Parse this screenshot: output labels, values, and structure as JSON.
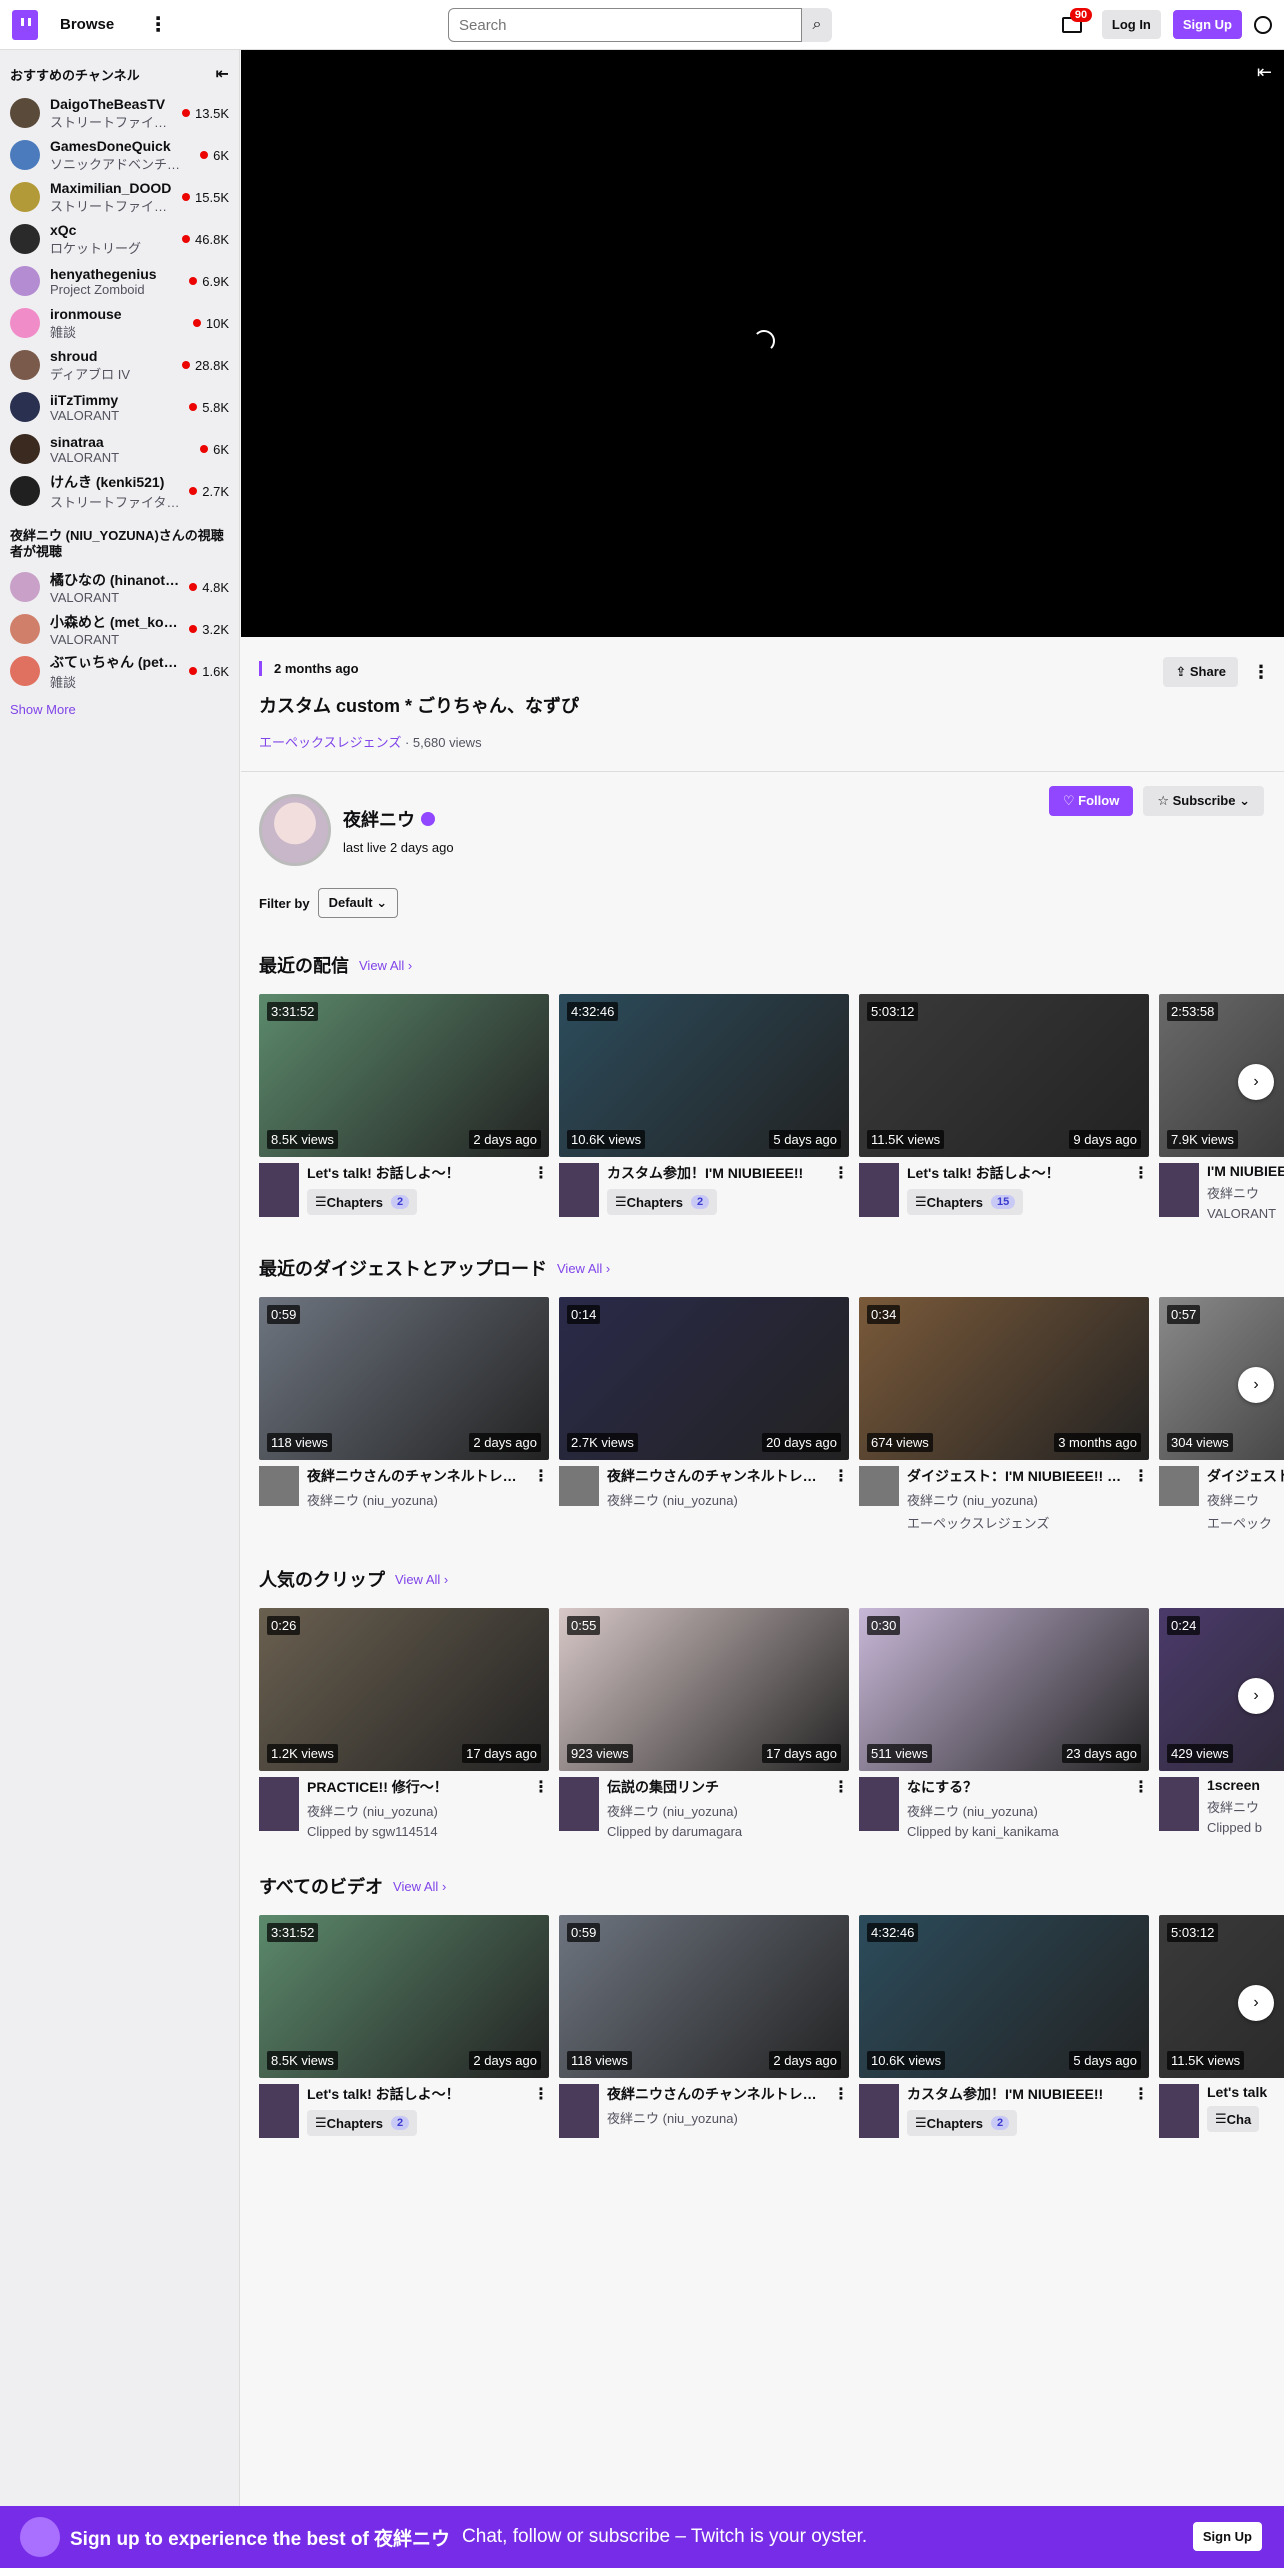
{
  "nav": {
    "browse": "Browse",
    "search_placeholder": "Search",
    "inbox_count": "90",
    "login": "Log In",
    "signup": "Sign Up"
  },
  "sidebar": {
    "title": "おすすめのチャンネル",
    "channels": [
      {
        "name": "DaigoTheBeasTV",
        "game": "ストリートファイ…",
        "viewers": "13.5K",
        "color": "#5a4a3a"
      },
      {
        "name": "GamesDoneQuick",
        "game": "ソニックアドベンチ…",
        "viewers": "6K",
        "color": "#4c7bbd"
      },
      {
        "name": "Maximilian_DOOD",
        "game": "ストリートファイ…",
        "viewers": "15.5K",
        "color": "#b39a39"
      },
      {
        "name": "xQc",
        "game": "ロケットリーグ",
        "viewers": "46.8K",
        "color": "#2a2a2a"
      },
      {
        "name": "henyathegenius",
        "game": "Project Zomboid",
        "viewers": "6.9K",
        "color": "#b48cd2"
      },
      {
        "name": "ironmouse",
        "game": "雑談",
        "viewers": "10K",
        "color": "#f08cc8"
      },
      {
        "name": "shroud",
        "game": "ディアブロ IV",
        "viewers": "28.8K",
        "color": "#7a5a4a"
      },
      {
        "name": "iiTzTimmy",
        "game": "VALORANT",
        "viewers": "5.8K",
        "color": "#2a3050"
      },
      {
        "name": "sinatraa",
        "game": "VALORANT",
        "viewers": "6K",
        "color": "#3a2a20"
      },
      {
        "name": "けんき (kenki521)",
        "game": "ストリートファイタ…",
        "viewers": "2.7K",
        "color": "#202020"
      }
    ],
    "viewers_also": "夜絆ニウ (NIU_YOZUNA)さんの視聴者が視聴",
    "also_channels": [
      {
        "name": "橘ひなの (hinanot…",
        "game": "VALORANT",
        "viewers": "4.8K",
        "color": "#c8a0c8"
      },
      {
        "name": "小森めと (met_ko…",
        "game": "VALORANT",
        "viewers": "3.2K",
        "color": "#d0806a"
      },
      {
        "name": "ぶてぃちゃん (petit…",
        "game": "雑談",
        "viewers": "1.6K",
        "color": "#e07060"
      }
    ],
    "show_more": "Show More"
  },
  "video": {
    "date": "2 months ago",
    "title": "カスタム custom * ごりちゃん、なずぴ",
    "game": "エーペックスレジェンズ",
    "views": "· 5,680 views",
    "share": "Share"
  },
  "creator": {
    "name": "夜絆ニウ",
    "last_live": "last live 2 days ago",
    "follow": "Follow",
    "subscribe": "Subscribe"
  },
  "filter": {
    "label": "Filter by",
    "value": "Default"
  },
  "sections": [
    {
      "title": "最近の配信",
      "view_all": "View All",
      "cards": [
        {
          "duration": "3:31:52",
          "views": "8.5K views",
          "age": "2 days ago",
          "title": "Let's talk! お話しよ～！",
          "chapters": "Chapters",
          "chapter_count": "2",
          "color": "#5c8a6c"
        },
        {
          "duration": "4:32:46",
          "views": "10.6K views",
          "age": "5 days ago",
          "title": "カスタム参加！I'M NIUBIEEE!!",
          "chapters": "Chapters",
          "chapter_count": "2",
          "color": "#2c4c5c"
        },
        {
          "duration": "5:03:12",
          "views": "11.5K views",
          "age": "9 days ago",
          "title": "Let's talk! お話しよ～！",
          "chapters": "Chapters",
          "chapter_count": "15",
          "color": "#3a3a3a"
        },
        {
          "duration": "2:53:58",
          "views": "7.9K views",
          "age": "",
          "title": "I'M NIUBIEEE",
          "sub1": "夜絆ニウ",
          "sub2": "VALORANT",
          "color": "#6a6a6a"
        }
      ]
    },
    {
      "title": "最近のダイジェストとアップロード",
      "view_all": "View All",
      "cards": [
        {
          "duration": "0:59",
          "views": "118 views",
          "age": "2 days ago",
          "title": "夜絆ニウさんのチャンネルトレ…",
          "sub1": "夜絆ニウ (niu_yozuna)",
          "color": "#6e7580"
        },
        {
          "duration": "0:14",
          "views": "2.7K views",
          "age": "20 days ago",
          "title": "夜絆ニウさんのチャンネルトレ…",
          "sub1": "夜絆ニウ (niu_yozuna)",
          "color": "#2a2a4a"
        },
        {
          "duration": "0:34",
          "views": "674 views",
          "age": "3 months ago",
          "title": "ダイジェスト：I'M NIUBIEEE!! p…",
          "sub1": "夜絆ニウ (niu_yozuna)",
          "sub2": "エーペックスレジェンズ",
          "color": "#7a5a3a"
        },
        {
          "duration": "0:57",
          "views": "304 views",
          "age": "",
          "title": "ダイジェスト",
          "sub1": "夜絆ニウ",
          "sub2": "エーペック",
          "color": "#8a8a8a"
        }
      ]
    },
    {
      "title": "人気のクリップ",
      "view_all": "View All",
      "cards": [
        {
          "duration": "0:26",
          "views": "1.2K views",
          "age": "17 days ago",
          "title": "PRACTICE!! 修行～！",
          "sub1": "夜絆ニウ (niu_yozuna)",
          "sub2": "Clipped by sgw114514",
          "color": "#6a6050"
        },
        {
          "duration": "0:55",
          "views": "923 views",
          "age": "17 days ago",
          "title": "伝説の集団リンチ",
          "sub1": "夜絆ニウ (niu_yozuna)",
          "sub2": "Clipped by darumagara",
          "color": "#d8c8c8"
        },
        {
          "duration": "0:30",
          "views": "511 views",
          "age": "23 days ago",
          "title": "なにする？",
          "sub1": "夜絆ニウ (niu_yozuna)",
          "sub2": "Clipped by kani_kanikama",
          "color": "#c8b8d8"
        },
        {
          "duration": "0:24",
          "views": "429 views",
          "age": "",
          "title": "1screen",
          "sub1": "夜絆ニウ",
          "sub2": "Clipped b",
          "color": "#4a3a6a"
        }
      ]
    },
    {
      "title": "すべてのビデオ",
      "view_all": "View All",
      "cards": [
        {
          "duration": "3:31:52",
          "views": "8.5K views",
          "age": "2 days ago",
          "title": "Let's talk! お話しよ～！",
          "chapters": "Chapters",
          "chapter_count": "2",
          "color": "#5c8a6c"
        },
        {
          "duration": "0:59",
          "views": "118 views",
          "age": "2 days ago",
          "title": "夜絆ニウさんのチャンネルトレ…",
          "sub1": "夜絆ニウ (niu_yozuna)",
          "color": "#6e7580"
        },
        {
          "duration": "4:32:46",
          "views": "10.6K views",
          "age": "5 days ago",
          "title": "カスタム参加！I'M NIUBIEEE!!",
          "chapters": "Chapters",
          "chapter_count": "2",
          "color": "#2c4c5c"
        },
        {
          "duration": "5:03:12",
          "views": "11.5K views",
          "age": "",
          "title": "Let's talk",
          "chapters": "Cha",
          "color": "#3a3a3a"
        }
      ]
    }
  ],
  "banner": {
    "main": "Sign up to experience the best of 夜絆ニウ",
    "sub": "Chat, follow or subscribe – Twitch is your oyster.",
    "button": "Sign Up"
  }
}
